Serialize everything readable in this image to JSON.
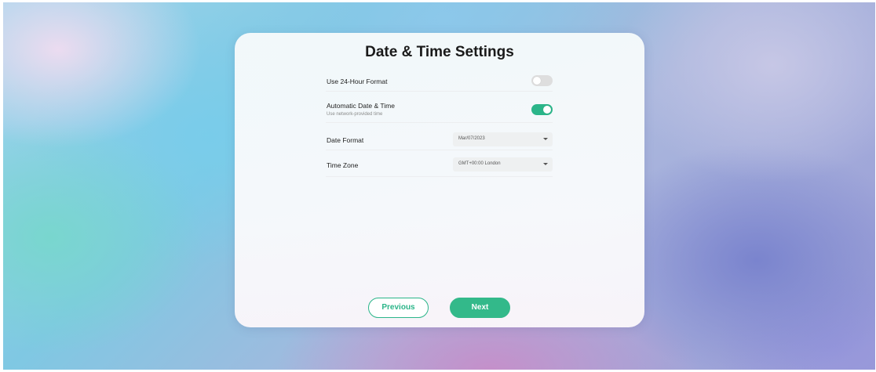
{
  "dialog": {
    "title": "Date & Time Settings"
  },
  "settings": {
    "hour_format": {
      "label": "Use 24-Hour Format",
      "enabled": false
    },
    "auto_time": {
      "label": "Automatic Date & Time",
      "sublabel": "Use network-provided time",
      "enabled": true
    },
    "date_format": {
      "label": "Date Format",
      "value": "Mar/07/2023"
    },
    "time_zone": {
      "label": "Time Zone",
      "value": "GMT+00:00 London"
    }
  },
  "buttons": {
    "previous": "Previous",
    "next": "Next"
  },
  "colors": {
    "accent": "#2bb589",
    "toggle_off": "#dedede"
  },
  "icons": {
    "select_caret": "chevron-down-icon"
  }
}
